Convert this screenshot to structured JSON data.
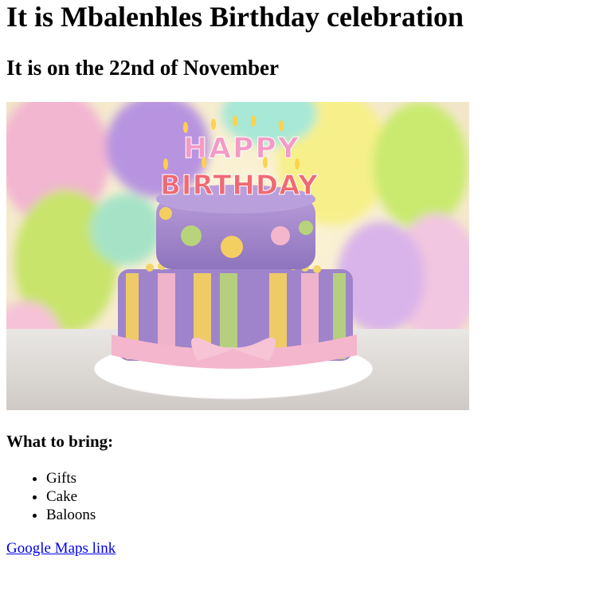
{
  "page": {
    "title": "It is Mbalenhles Birthday celebration",
    "date_heading": "It is on the 22nd of November",
    "image": {
      "description_icon": "birthday-cake-photo",
      "topper_line1": "HAPPY",
      "topper_line2": "BIRTHDAY"
    },
    "bring_heading": "What to bring:",
    "bring_items": [
      "Gifts",
      "Cake",
      "Baloons"
    ],
    "map_link": "Google Maps link",
    "colors": {
      "link": "#0000ee",
      "cake_purple": "#a98ccf",
      "ribbon_pink": "#f4b6cc",
      "stripe_yellow": "#f3cf62",
      "stripe_green": "#b7d47a"
    }
  }
}
